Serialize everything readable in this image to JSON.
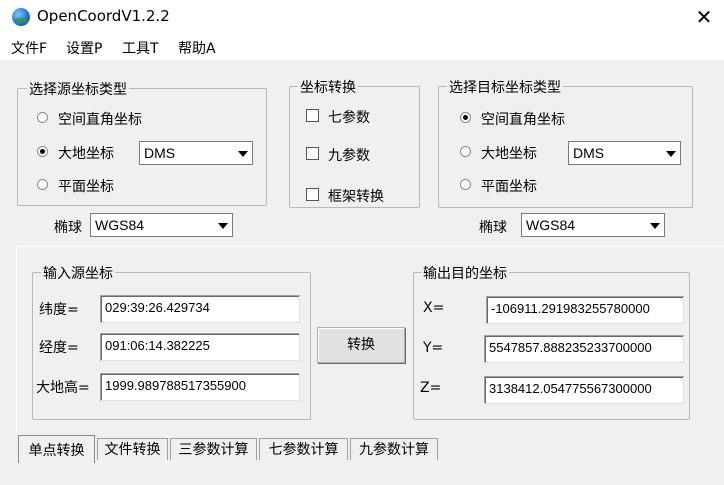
{
  "window": {
    "title": "OpenCoordV1.2.2",
    "close_glyph": "✕"
  },
  "menu": [
    {
      "label": "文件F"
    },
    {
      "label": "设置P"
    },
    {
      "label": "工具T"
    },
    {
      "label": "帮助A"
    }
  ],
  "source_type": {
    "legend": "选择源坐标类型",
    "options": [
      {
        "label": "空间直角坐标",
        "selected": false
      },
      {
        "label": "大地坐标",
        "selected": true
      },
      {
        "label": "平面坐标",
        "selected": false
      }
    ],
    "format_value": "DMS",
    "ellipsoid_label": "椭球",
    "ellipsoid_value": "WGS84"
  },
  "transform": {
    "legend": "坐标转换",
    "options": [
      {
        "label": "七参数",
        "checked": false
      },
      {
        "label": "九参数",
        "checked": false
      },
      {
        "label": "框架转换",
        "checked": false
      }
    ]
  },
  "target_type": {
    "legend": "选择目标坐标类型",
    "options": [
      {
        "label": "空间直角坐标",
        "selected": true
      },
      {
        "label": "大地坐标",
        "selected": false
      },
      {
        "label": "平面坐标",
        "selected": false
      }
    ],
    "format_value": "DMS",
    "ellipsoid_label": "椭球",
    "ellipsoid_value": "WGS84"
  },
  "input": {
    "legend": "输入源坐标",
    "fields": [
      {
        "label": "纬度=",
        "value": "029:39:26.429734"
      },
      {
        "label": "经度=",
        "value": "091:06:14.382225"
      },
      {
        "label": "大地高=",
        "value": "1999.989788517355900"
      }
    ]
  },
  "convert_label": "转换",
  "output": {
    "legend": "输出目的坐标",
    "fields": [
      {
        "label": "X=",
        "value": "-106911.291983255780000"
      },
      {
        "label": "Y=",
        "value": "5547857.888235233700000"
      },
      {
        "label": "Z=",
        "value": "3138412.054775567300000"
      }
    ]
  },
  "tabs": [
    {
      "label": "单点转换",
      "active": true
    },
    {
      "label": "文件转换",
      "active": false
    },
    {
      "label": "三参数计算",
      "active": false
    },
    {
      "label": "七参数计算",
      "active": false
    },
    {
      "label": "九参数计算",
      "active": false
    }
  ]
}
